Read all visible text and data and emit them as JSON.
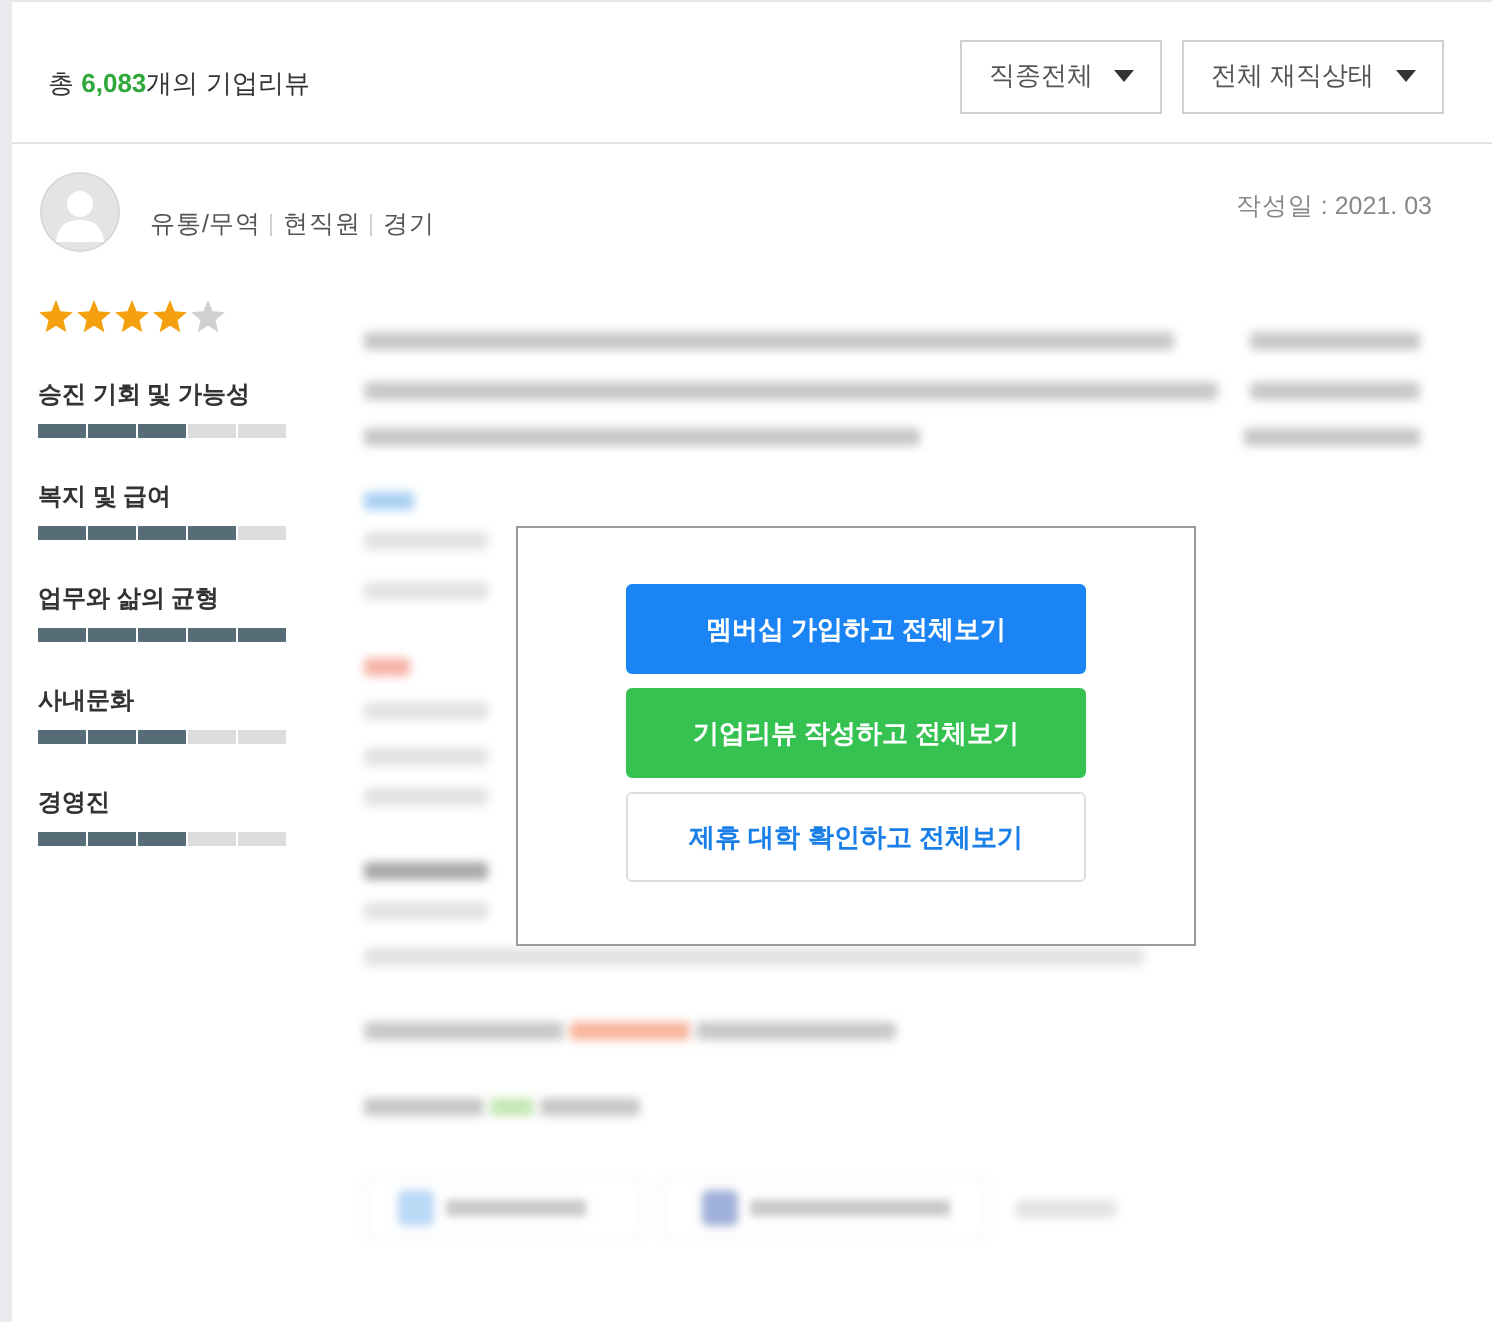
{
  "header": {
    "summary": {
      "prefix": "총 ",
      "count": "6,083",
      "suffix": "개의 기업리뷰"
    },
    "filters": [
      {
        "label": "직종전체"
      },
      {
        "label": "전체 재직상태"
      }
    ]
  },
  "review": {
    "author_meta": [
      "유통/무역",
      "현직원",
      "경기"
    ],
    "date": "작성일 : 2021. 03",
    "stars": 4,
    "ratings": [
      {
        "label": "승진 기회 및 가능성",
        "level": 0.6
      },
      {
        "label": "복지 및 급여",
        "level": 0.8
      },
      {
        "label": "업무와 삶의 균형",
        "level": 1
      },
      {
        "label": "사내문화",
        "level": 0.6
      },
      {
        "label": "경영진",
        "level": 0.6
      }
    ]
  },
  "unlock_overlay": {
    "buttons": [
      {
        "kind": "primary",
        "label": "멤버십 가입하고 전체보기"
      },
      {
        "kind": "success",
        "label": "기업리뷰 작성하고 전체보기"
      },
      {
        "kind": "outline",
        "label": "제휴 대학 확인하고 전체보기"
      }
    ]
  }
}
